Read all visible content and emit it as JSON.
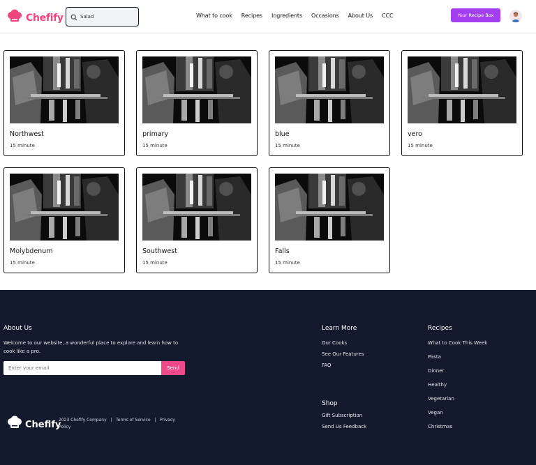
{
  "header": {
    "brand": "Chefify",
    "search_value": "Salad",
    "nav": [
      "What to cook",
      "Recipes",
      "Ingredients",
      "Occasions",
      "About Us",
      "CCC"
    ],
    "cta": "Your Recipe Box"
  },
  "cards": [
    {
      "title": "Northwest",
      "time": "15 minute"
    },
    {
      "title": "primary",
      "time": "15 minute"
    },
    {
      "title": "blue",
      "time": "15 minute"
    },
    {
      "title": "vero",
      "time": "15 minute"
    },
    {
      "title": "Molybdenum",
      "time": "15 minute"
    },
    {
      "title": "Southwest",
      "time": "15 minute"
    },
    {
      "title": "Falls",
      "time": "15 minute"
    }
  ],
  "footer": {
    "about_heading": "About Us",
    "about_text": "Welcome to our website, a wonderful place to explore and learn how to cook like a pro.",
    "email_placeholder": "Enter your email",
    "send_label": "Send",
    "learn_heading": "Learn More",
    "learn_links": [
      "Our Cooks",
      "See Our Features",
      "FAQ"
    ],
    "shop_heading": "Shop",
    "shop_links": [
      "Gift Subscription",
      "Send Us Feedback"
    ],
    "recipes_heading": "Recipes",
    "recipes_links": [
      "What to Cook This Week",
      "Pasta",
      "Dinner",
      "Healthy",
      "Vegetarian",
      "Vegan",
      "Christmas"
    ],
    "brand": "Chefify",
    "copyright": "2023 Chefify Company",
    "terms": "Terms of Service",
    "privacy": "Privacy Policy"
  }
}
